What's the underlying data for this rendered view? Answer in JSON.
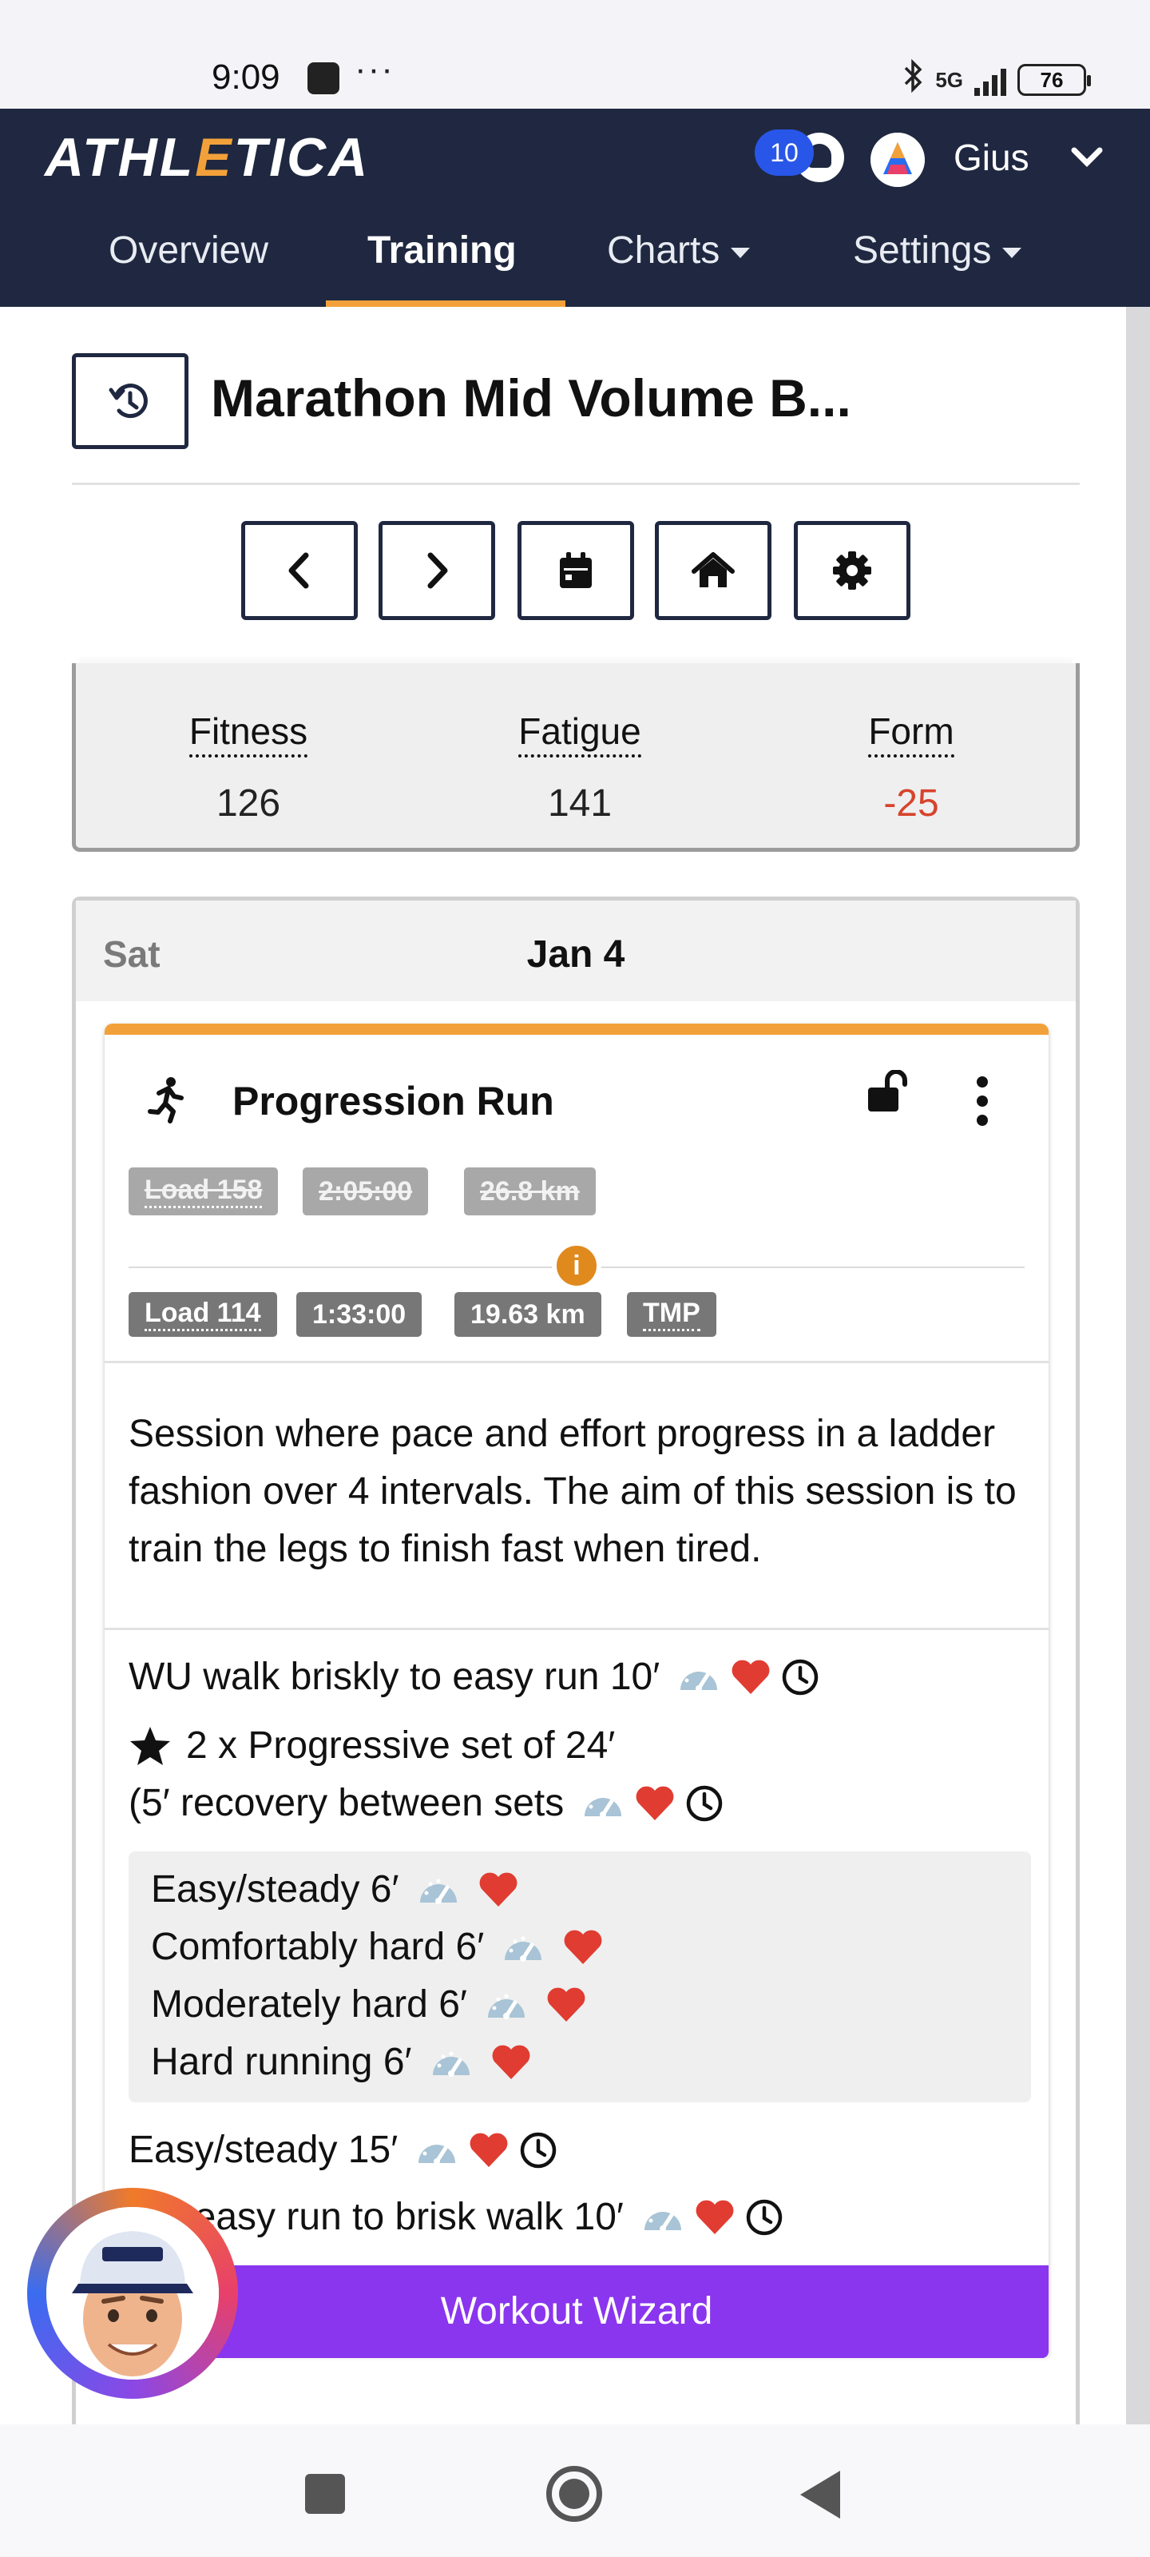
{
  "status_bar": {
    "time": "9:09",
    "more": "···",
    "network": "5G",
    "battery": "76"
  },
  "app": {
    "brand": "ATHLETICA",
    "notification_count": "10",
    "username": "Gius"
  },
  "tabs": [
    {
      "label": "Overview"
    },
    {
      "label": "Training"
    },
    {
      "label": "Charts"
    },
    {
      "label": "Settings"
    }
  ],
  "plan": {
    "title": "Marathon Mid Volume B..."
  },
  "stats": [
    {
      "label": "Fitness",
      "value": "126"
    },
    {
      "label": "Fatigue",
      "value": "141"
    },
    {
      "label": "Form",
      "value": "-25"
    }
  ],
  "day": {
    "weekday": "Sat",
    "date": "Jan 4"
  },
  "workout": {
    "title": "Progression Run",
    "planned": {
      "load": "Load 158",
      "duration": "2:05:00",
      "distance": "26.8 km"
    },
    "actual": {
      "load": "Load 114",
      "duration": "1:33:00",
      "distance": "19.63 km",
      "tag": "TMP"
    },
    "info": "i",
    "description": "Session where pace and effort progress in a ladder fashion over 4 intervals. The aim of this session is to train the legs to finish fast when tired.",
    "steps": {
      "warmup": "WU walk briskly to easy run 10′",
      "main": "2 x Progressive set of 24′",
      "recovery": "(5′ recovery between sets",
      "set": [
        "Easy/steady 6′",
        "Comfortably hard 6′",
        "Moderately hard 6′",
        "Hard running 6′"
      ],
      "easy": "Easy/steady 15′",
      "cooldown": "CD easy run to brisk walk 10′"
    },
    "wizard_label": "Workout Wizard"
  },
  "colors": {
    "nav_bg": "#1f2840",
    "accent": "#f2a13a",
    "wizard": "#8a35ee",
    "negative": "#d6442c"
  }
}
